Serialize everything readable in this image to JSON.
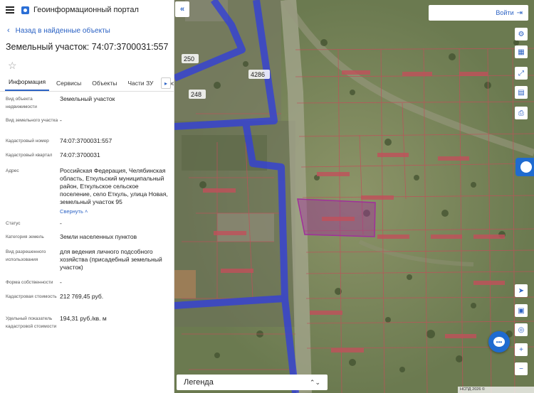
{
  "header": {
    "menu_icon": "hamburger-icon",
    "logo_icon": "portal-logo-icon",
    "title": "Геоинформационный портал"
  },
  "nav": {
    "back_label": "Назад в найденные объекты"
  },
  "object": {
    "title": "Земельный участок: 74:07:3700031:557"
  },
  "tabs": [
    {
      "label": "Информация",
      "active": true
    },
    {
      "label": "Сервисы"
    },
    {
      "label": "Объекты"
    },
    {
      "label": "Части ЗУ"
    },
    {
      "label": "Состав"
    }
  ],
  "attributes": [
    {
      "key": "Вид объекта недвижимости",
      "value": "Земельный участок"
    },
    {
      "key": "Вид земельного участка",
      "value": "-"
    },
    {
      "key": "Кадастровый номер",
      "value": "74:07:3700031:557"
    },
    {
      "key": "Кадастровый квартал",
      "value": "74:07:3700031"
    },
    {
      "key": "Адрес",
      "value": "Российская Федерация, Челябинская область, Еткульский муниципальный район, Еткульское сельское поселение, село Еткуль, улица Новая, земельный участок 95"
    },
    {
      "key": "Статус",
      "value": "-"
    },
    {
      "key": "Категория земель",
      "value": "Земли населенных пунктов"
    },
    {
      "key": "Вид разрешенного использования",
      "value": "для ведения личного подсобного хозяйства (присадебный земельный участок)"
    },
    {
      "key": "Форма собственности",
      "value": "-"
    },
    {
      "key": "Кадастровая стоимость",
      "value": "212 769,45 руб."
    },
    {
      "key": "Удельный показатель кадастровой стоимости",
      "value": "194,31 руб./кв. м"
    }
  ],
  "collapse_label": "Свернуть",
  "map": {
    "login_label": "Войти",
    "legend_label": "Легенда",
    "copyright": "НСПД 2026 ©",
    "labels": [
      "250",
      "4286",
      "248"
    ],
    "highlight_color": "#a0309a",
    "boundary_color": "#3340d8",
    "parcel_line_color": "#c0505a"
  },
  "tools": [
    "layers-icon",
    "map-base-icon",
    "measure-icon",
    "print-icon",
    "locate-icon",
    "screen-icon",
    "identify-icon",
    "zoom-in-icon",
    "zoom-out-icon"
  ]
}
